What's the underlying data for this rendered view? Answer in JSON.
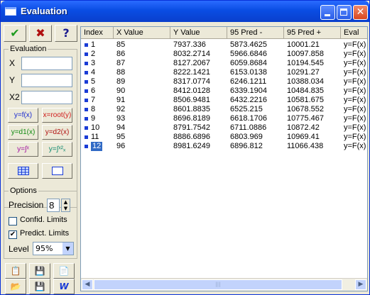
{
  "window": {
    "title": "Evaluation"
  },
  "toolbar": {
    "ok_label": "✔",
    "cancel_label": "✖",
    "help_label": "?"
  },
  "evaluation": {
    "title": "Evaluation",
    "x_label": "X",
    "y_label": "Y",
    "x2_label": "X2",
    "x_value": "",
    "y_value": "",
    "x2_value": "",
    "buttons": [
      "y=f(x)",
      "x=root(y)",
      "y=d1(x)",
      "y=d2(x)",
      "y=∫ˣ",
      "y=∫ˣ²ₓ"
    ]
  },
  "options": {
    "title": "Options",
    "precision_label": "Precision",
    "precision_value": "8",
    "confid_label": "Confid. Limits",
    "confid_checked": "",
    "predict_label": "Predict. Limits",
    "predict_checked": "✔",
    "level_label": "Level",
    "level_value": "95%"
  },
  "table": {
    "columns": [
      "Index",
      "X Value",
      "Y Value",
      "95 Pred -",
      "95 Pred +",
      "Eval"
    ],
    "rows": [
      [
        "1",
        "85",
        "7937.336",
        "5873.4625",
        "10001.21",
        "y=F(x)"
      ],
      [
        "2",
        "86",
        "8032.2714",
        "5966.6846",
        "10097.858",
        "y=F(x)"
      ],
      [
        "3",
        "87",
        "8127.2067",
        "6059.8684",
        "10194.545",
        "y=F(x)"
      ],
      [
        "4",
        "88",
        "8222.1421",
        "6153.0138",
        "10291.27",
        "y=F(x)"
      ],
      [
        "5",
        "89",
        "8317.0774",
        "6246.1211",
        "10388.034",
        "y=F(x)"
      ],
      [
        "6",
        "90",
        "8412.0128",
        "6339.1904",
        "10484.835",
        "y=F(x)"
      ],
      [
        "7",
        "91",
        "8506.9481",
        "6432.2216",
        "10581.675",
        "y=F(x)"
      ],
      [
        "8",
        "92",
        "8601.8835",
        "6525.215",
        "10678.552",
        "y=F(x)"
      ],
      [
        "9",
        "93",
        "8696.8189",
        "6618.1706",
        "10775.467",
        "y=F(x)"
      ],
      [
        "10",
        "94",
        "8791.7542",
        "6711.0886",
        "10872.42",
        "y=F(x)"
      ],
      [
        "11",
        "95",
        "8886.6896",
        "6803.969",
        "10969.41",
        "y=F(x)"
      ],
      [
        "12",
        "96",
        "8981.6249",
        "6896.812",
        "11066.438",
        "y=F(x)"
      ]
    ],
    "selected_row_index": 11
  },
  "scrollbar": {
    "left_arrow": "◀",
    "right_arrow": "▶",
    "thumb_grip": "|||"
  },
  "colors": {
    "titlebar": "#0a4de3",
    "selection": "#316ac5",
    "row_marker": "#1a3cd6"
  }
}
